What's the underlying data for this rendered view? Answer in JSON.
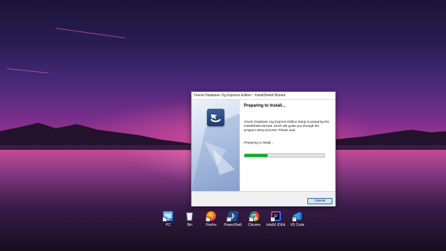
{
  "dialog": {
    "title": "Oracle Database 11g Express Edition - InstallShield Wizard",
    "heading": "Preparing to Install...",
    "description": "Oracle Database 11g Express Edition Setup is preparing the InstallShield Wizard, which will guide you through the program setup process.  Please wait.",
    "status": "Preparing to Install...",
    "progress_fraction": 0.29,
    "cancel_label": "Cancel"
  },
  "desktop_icons": [
    {
      "label": "PC",
      "icon": "pc-icon"
    },
    {
      "label": "Bin",
      "icon": "recycle-bin-icon"
    },
    {
      "label": "Firefox",
      "icon": "firefox-icon"
    },
    {
      "label": "PowerShell",
      "icon": "powershell-icon"
    },
    {
      "label": "Chrome",
      "icon": "chrome-icon"
    },
    {
      "label": "IntelliJ IDEA",
      "icon": "intellij-idea-icon"
    },
    {
      "label": "VS Code",
      "icon": "vscode-icon"
    }
  ],
  "colors": {
    "progress": "#06b025",
    "button_focus": "#0078d7"
  }
}
